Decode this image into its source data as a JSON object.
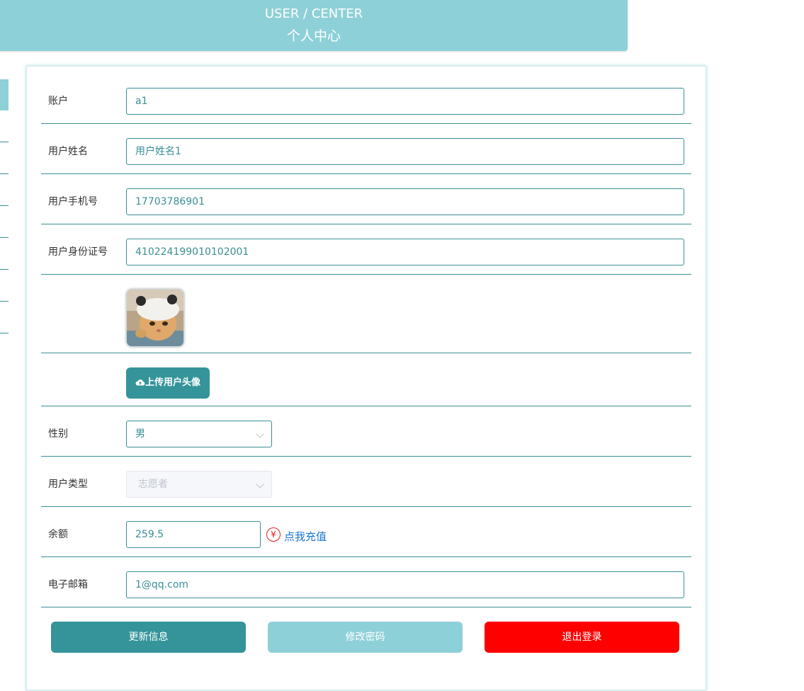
{
  "header": {
    "title_en": "USER / CENTER",
    "title_zh": "个人中心"
  },
  "form": {
    "account": {
      "label": "账户",
      "value": "a1"
    },
    "name": {
      "label": "用户姓名",
      "value": "用户姓名1"
    },
    "phone": {
      "label": "用户手机号",
      "value": "17703786901"
    },
    "id_card": {
      "label": "用户身份证号",
      "value": "410224199010102001"
    },
    "upload": {
      "label": "上传用户头像"
    },
    "gender": {
      "label": "性别",
      "value": "男"
    },
    "user_type": {
      "label": "用户类型",
      "value": "志愿者"
    },
    "balance": {
      "label": "余额",
      "value": "259.5",
      "recharge_icon": "¥",
      "recharge_label": "点我充值"
    },
    "email": {
      "label": "电子邮箱",
      "value": "1@qq.com"
    }
  },
  "buttons": {
    "update": "更新信息",
    "change_password": "修改密码",
    "logout": "退出登录"
  },
  "colors": {
    "header_bg": "#8ed0d7",
    "primary": "#34949a",
    "secondary": "#8ed0d7",
    "danger": "#ff0000",
    "link": "#1976d2"
  }
}
